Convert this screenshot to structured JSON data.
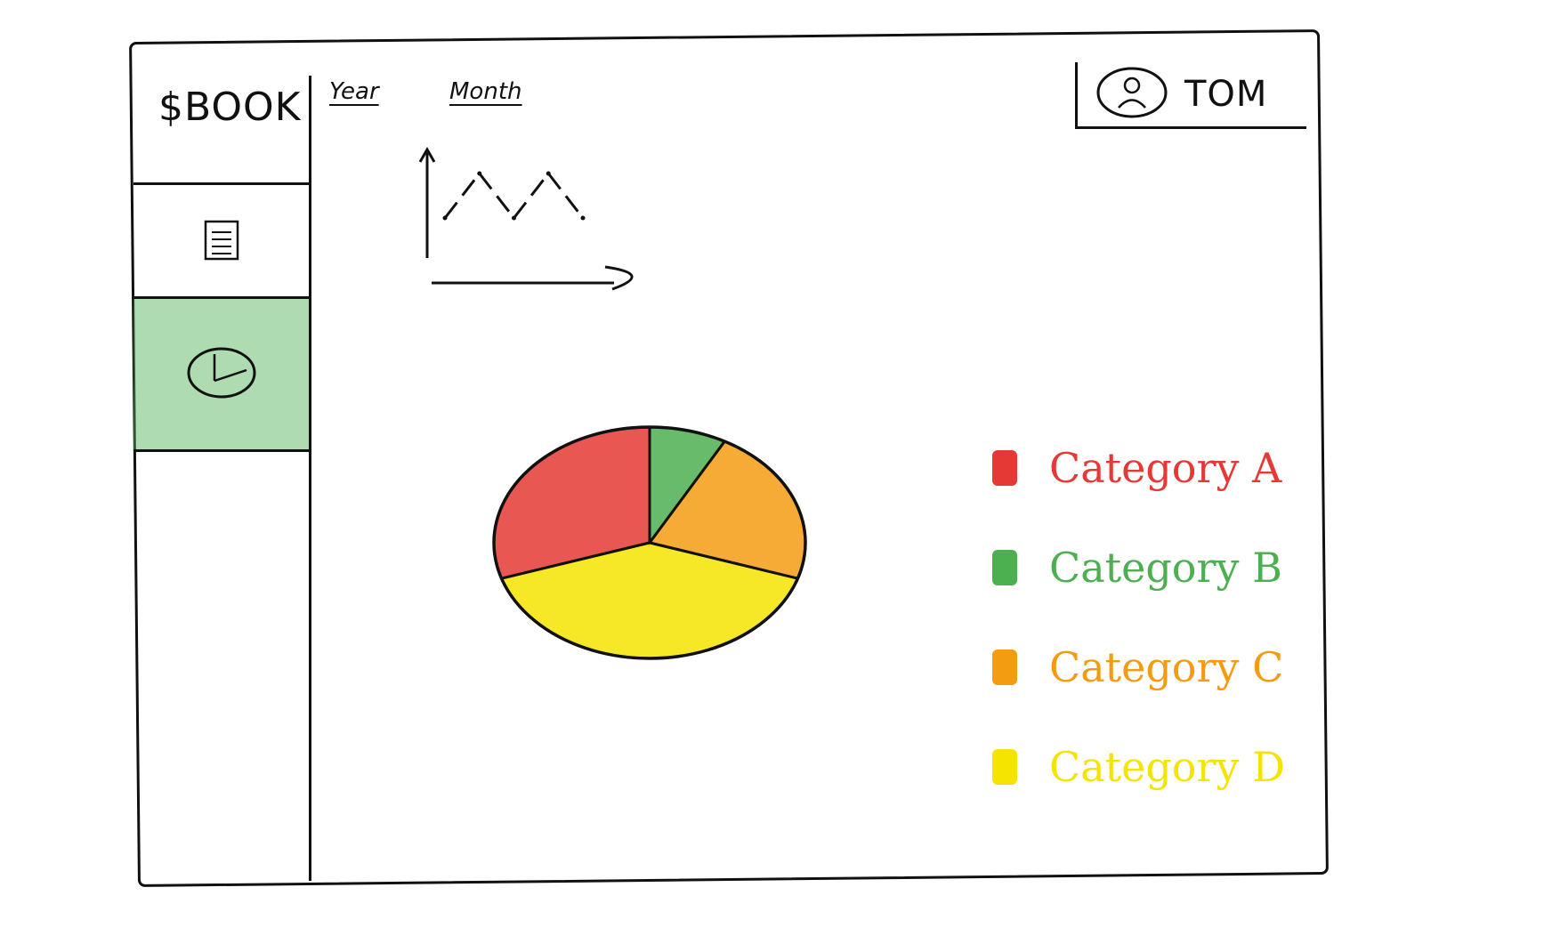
{
  "app": {
    "brand": "$BOOK"
  },
  "sidebar": {
    "items": [
      {
        "name": "ledger",
        "icon": "document-icon",
        "active": false
      },
      {
        "name": "statistics",
        "icon": "pie-chart-icon",
        "active": true
      }
    ]
  },
  "toolbar": {
    "tabs": [
      {
        "label": "Year"
      },
      {
        "label": "Month"
      }
    ]
  },
  "user": {
    "name": "TOM",
    "icon": "user-avatar-icon"
  },
  "chart_data": [
    {
      "type": "line",
      "title": "",
      "xlabel": "",
      "ylabel": "",
      "grid": false,
      "series": [
        {
          "values": [
            2,
            4,
            2,
            4,
            2
          ]
        }
      ]
    },
    {
      "type": "pie",
      "title": "",
      "legend_position": "right",
      "slices": [
        {
          "label": "Category A",
          "value": 30,
          "color": "#e53935"
        },
        {
          "label": "Category B",
          "value": 8,
          "color": "#4caf50"
        },
        {
          "label": "Category C",
          "value": 22,
          "color": "#f39c12"
        },
        {
          "label": "Category D",
          "value": 40,
          "color": "#f5e400"
        }
      ]
    }
  ],
  "colors": {
    "active_nav": "#4caf50",
    "stroke": "#111111"
  }
}
